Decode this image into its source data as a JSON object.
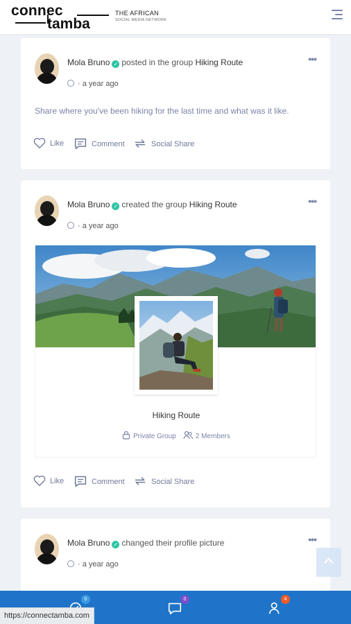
{
  "header": {
    "logo_line1": "connec",
    "logo_line2": "tamba",
    "tagline_main": "THE AFRICAN",
    "tagline_sub": "SOCIAL MEDIA NETWORK"
  },
  "posts": [
    {
      "author": "Mola Bruno",
      "action": "posted in the group",
      "group": "Hiking Route",
      "time": "a year ago",
      "text": "Share where you've been hiking for the last time and what was it like.",
      "actions": [
        "Like",
        "Comment",
        "Social Share"
      ]
    },
    {
      "author": "Mola Bruno",
      "action": "created the group",
      "group": "Hiking Route",
      "time": "a year ago",
      "group_card": {
        "name": "Hiking Route",
        "privacy": "Private Group",
        "members": "2 Members"
      },
      "actions": [
        "Like",
        "Comment",
        "Social Share"
      ]
    },
    {
      "author": "Mola Bruno",
      "action": "changed their profile picture",
      "time": "a year ago"
    }
  ],
  "meta_separator": "·",
  "bottom_nav": {
    "items": [
      {
        "icon": "notifications-icon",
        "badge": "0",
        "badge_color": "#3b9ae1"
      },
      {
        "icon": "messages-icon",
        "badge": "0",
        "badge_color": "#7b4fc9"
      },
      {
        "icon": "friend-requests-icon",
        "badge": "4",
        "badge_color": "#f05a28"
      }
    ]
  },
  "status_url": "https://connectamba.com",
  "colors": {
    "primary": "#1f74c9",
    "verified": "#2ec4a5",
    "muted_text": "#7a84a8"
  }
}
